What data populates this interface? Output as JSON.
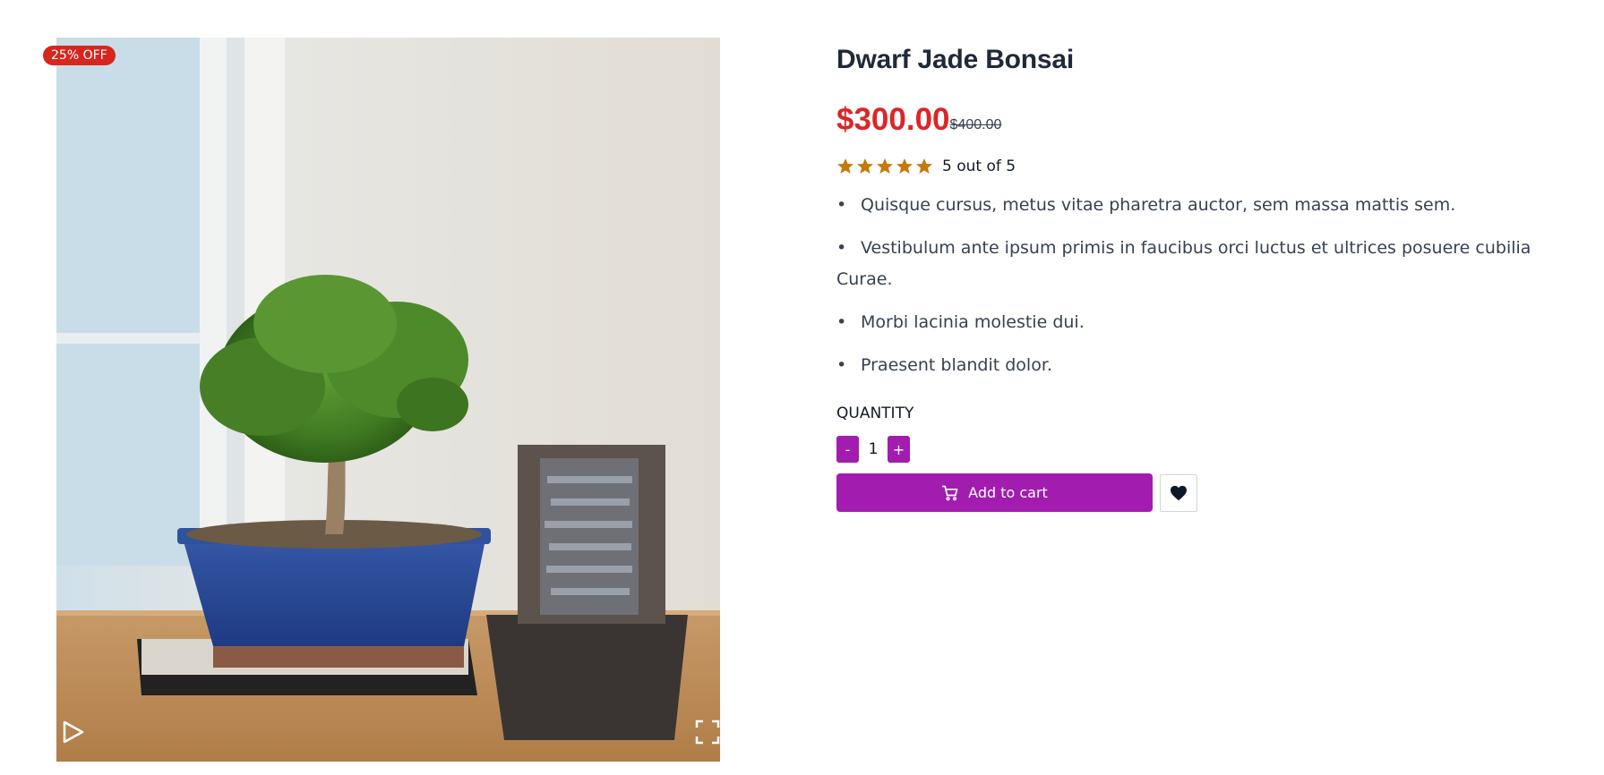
{
  "product": {
    "title": "Dwarf Jade Bonsai",
    "discount_badge": "25% OFF",
    "price": "$300.00",
    "old_price": "$400.00",
    "rating": 5,
    "rating_text": "5 out of 5",
    "features": [
      "Quisque cursus, metus vitae pharetra auctor, sem massa mattis sem.",
      "Vestibulum ante ipsum primis in faucibus orci luctus et ultrices posuere cubilia Curae.",
      "Morbi lacinia molestie dui.",
      "Praesent blandit dolor."
    ]
  },
  "purchase": {
    "quantity_label": "QUANTITY",
    "quantity_value": "1",
    "decrement_label": "-",
    "increment_label": "+",
    "add_to_cart_label": "Add to cart"
  },
  "icons": {
    "play": "play-icon",
    "expand": "expand-icon",
    "cart": "cart-icon",
    "wishlist": "heart-icon",
    "star": "star-icon"
  },
  "colors": {
    "accent": "#a21caf",
    "price": "#dc2626",
    "badge": "#d7261e",
    "star": "#c47a09",
    "thumb_border": "#2a6fb0"
  }
}
